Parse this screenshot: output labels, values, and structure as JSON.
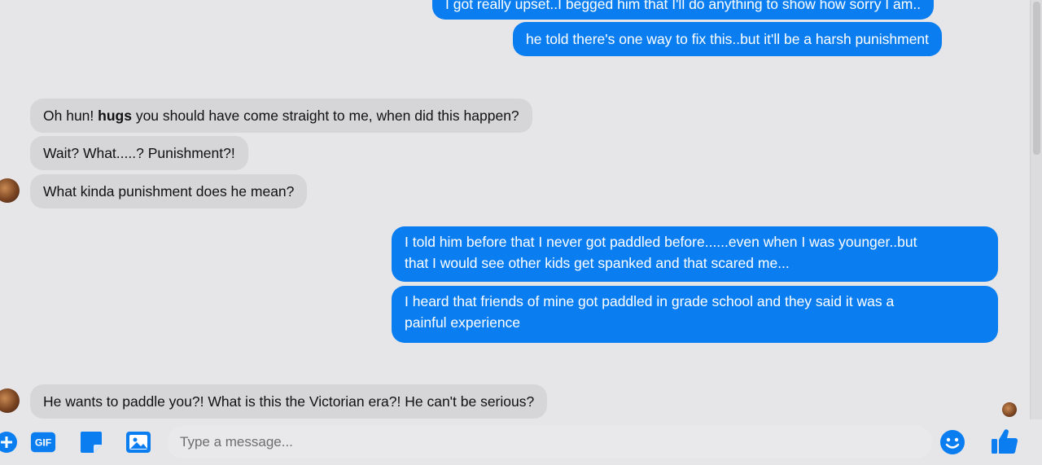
{
  "messages": [
    {
      "text": "I got really upset..I begged him that I'll do anything to show how sorry I am.."
    },
    {
      "text": "he told there's one way to fix this..but it'll be a harsh punishment"
    },
    {
      "parts": [
        "Oh hun! ",
        "hugs",
        " you should have come straight to me, when did this happen?"
      ]
    },
    {
      "text": "Wait? What.....? Punishment?!"
    },
    {
      "text": "What kinda punishment does he mean?"
    },
    {
      "lines": [
        "I told him before that I never got paddled before......even when I was younger..but",
        "that I would see other kids get spanked and that scared me..."
      ]
    },
    {
      "lines": [
        "I heard that friends of mine got paddled in grade school and they said it was a",
        "painful experience"
      ]
    },
    {
      "text": "He wants to paddle you?! What is this the Victorian era?! He can't be serious?"
    }
  ],
  "composer": {
    "placeholder": "Type a message...",
    "gif_label": "GIF"
  },
  "colors": {
    "outgoing_bubble": "#0a7ef0",
    "incoming_bubble": "#d6d6d8",
    "accent": "#0a7ef0"
  },
  "icons": [
    "add-icon",
    "gif-icon",
    "sticker-icon",
    "image-icon",
    "emoji-icon",
    "thumbs-up-icon"
  ]
}
